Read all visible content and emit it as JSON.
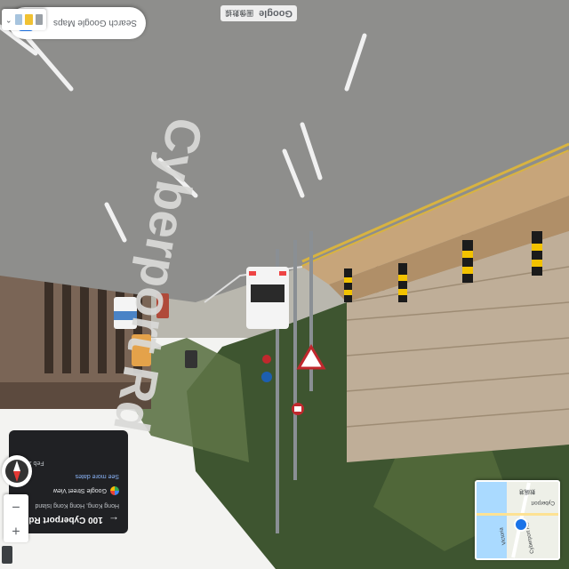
{
  "search": {
    "placeholder": "Search Google Maps"
  },
  "place_card": {
    "title": "100 Cyberport Rd",
    "subtitle": "Hong Kong, Hong Kong Island",
    "source": "Google Street View",
    "more_dates": "See more dates",
    "date": "Feb 2024"
  },
  "street_label": "Cyberport Rd",
  "minimap": {
    "labels": [
      "Cyberport",
      "數碼港",
      "Cyberport Rd",
      "Victoria"
    ]
  },
  "attribution": {
    "brand": "Google",
    "text": "圖像數據"
  },
  "icons": {
    "back": "arrow-left-icon",
    "pin": "location-pin-icon",
    "directions": "directions-icon",
    "search": "search-icon",
    "compass": "compass-icon",
    "zoom_in": "plus-icon",
    "zoom_out": "minus-icon",
    "expand": "chevron-icon"
  },
  "colors": {
    "accent": "#1a73e8",
    "card_bg": "#202124"
  }
}
